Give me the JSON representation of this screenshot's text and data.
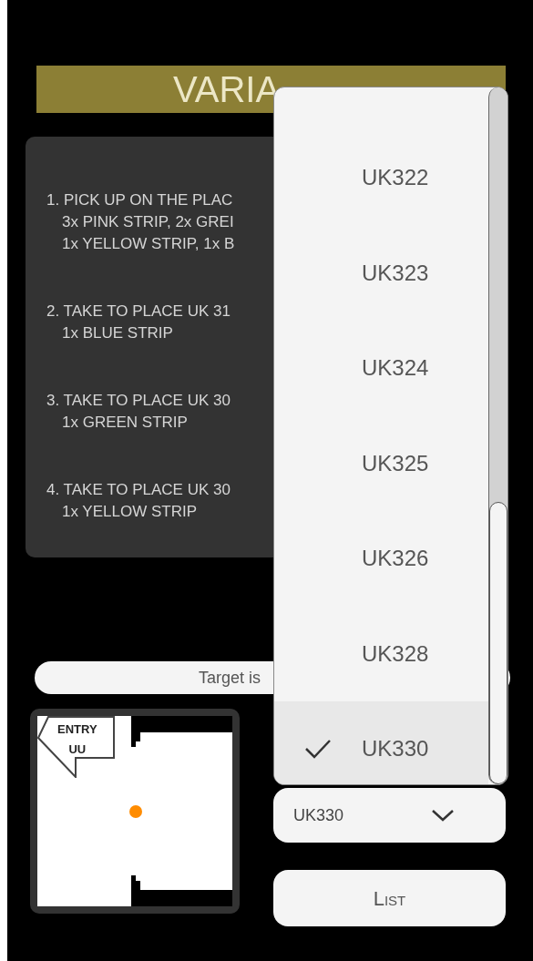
{
  "title": "VARIA",
  "steps": [
    {
      "lines": [
        "1. PICK UP ON THE PLAC",
        "3x PINK STRIP, 2x GREI",
        "1x YELLOW STRIP, 1x B"
      ]
    },
    {
      "lines": [
        "2. TAKE TO PLACE UK 31",
        "1x BLUE STRIP"
      ]
    },
    {
      "lines": [
        "3. TAKE TO PLACE UK 30",
        "1x GREEN STRIP"
      ]
    },
    {
      "lines": [
        "4. TAKE TO PLACE UK 30",
        "1x YELLOW STRIP"
      ]
    }
  ],
  "target_bar": "Target is",
  "map": {
    "entry_sign": [
      "ENTRY",
      "UU"
    ]
  },
  "dropdown_list": [
    {
      "label": "UK322",
      "selected": false
    },
    {
      "label": "UK323",
      "selected": false
    },
    {
      "label": "UK324",
      "selected": false
    },
    {
      "label": "UK325",
      "selected": false
    },
    {
      "label": "UK326",
      "selected": false
    },
    {
      "label": "UK328",
      "selected": false
    },
    {
      "label": "UK330",
      "selected": true
    }
  ],
  "dropdown": {
    "value": "UK330"
  },
  "list_button": "List"
}
